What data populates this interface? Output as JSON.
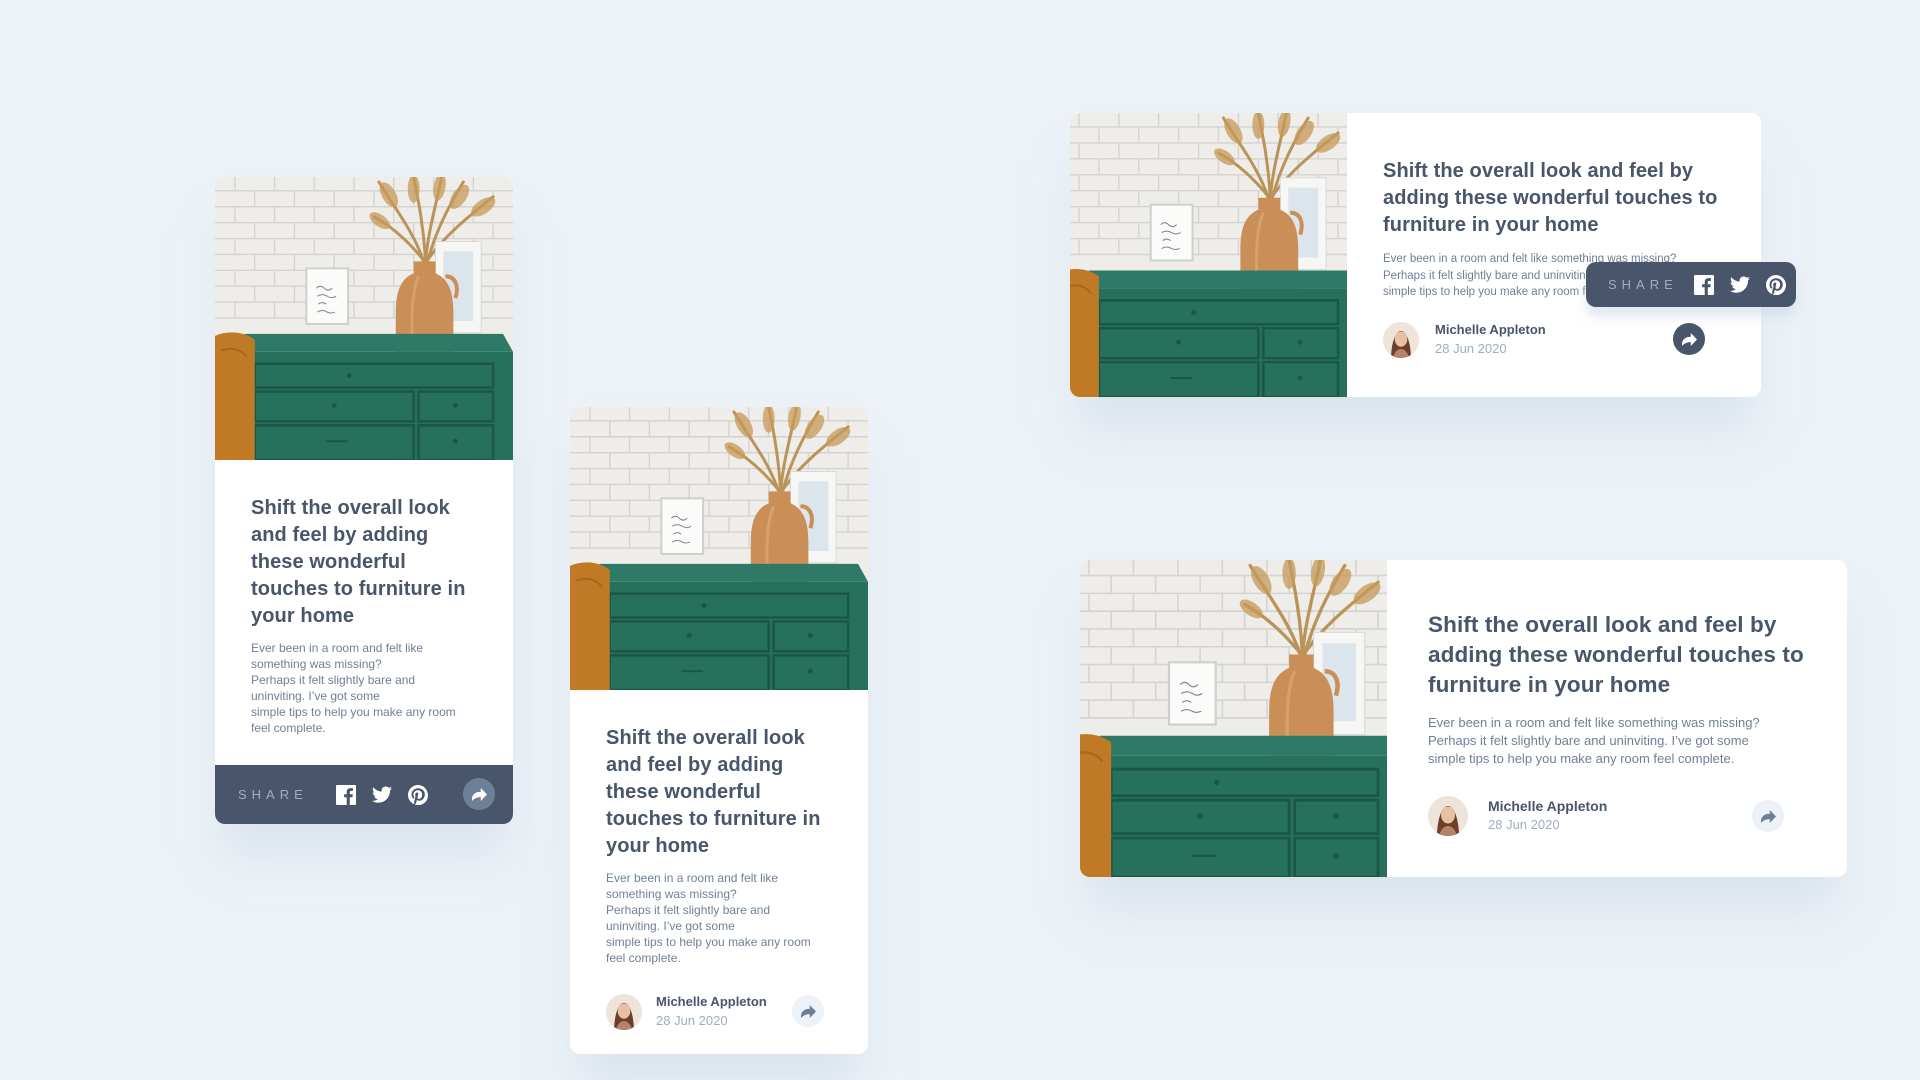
{
  "article": {
    "title": "Shift the overall look and feel by adding these wonderful touches to furniture in your home",
    "title_narrow": "Shift the overall look and feel by adding these wonderful touches to furniture in your home",
    "description": "Ever been in a room and felt like something was missing? Perhaps it felt slightly bare and uninviting. I’ve got some simple tips to help you make any room feel complete.",
    "desc_lines": [
      "Ever been in a room and felt like",
      "something was missing?",
      "Perhaps it felt slightly bare and",
      "uninviting. I’ve got some",
      "simple tips to help you make any room",
      "feel complete."
    ],
    "desc_lines_wide": [
      "Ever been in a room and felt like something was missing?",
      "Perhaps it felt slightly bare and uninviting. I’ve got some",
      "simple tips to help you make any room feel complete."
    ],
    "desc_lines_clipped": [
      "Ever been in a room and felt like something was missing?",
      "Perhaps it felt slightly bare and uninviting. I’ve got some",
      "simple tips to help you make any room feel complete."
    ],
    "author_name": "Michelle Appleton",
    "date": "28 Jun 2020"
  },
  "share": {
    "label": "SHARE",
    "icons": [
      "facebook-icon",
      "twitter-icon",
      "pinterest-icon",
      "share-arrow-icon"
    ]
  },
  "colors": {
    "background": "#ECF2F8",
    "navy": "#48556A",
    "grayish_blue": "#6E8098",
    "light_grayish_blue": "#9DAEC2"
  }
}
